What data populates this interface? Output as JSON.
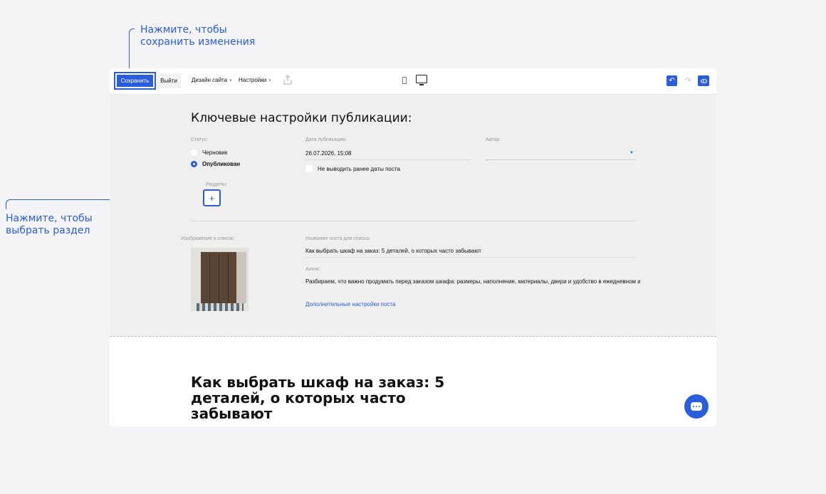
{
  "callouts": {
    "save_hint": "Нажмите, чтобы сохранить изменения",
    "section_hint": "Нажмите, чтобы выбрать раздел"
  },
  "toolbar": {
    "save_label": "Сохранить",
    "exit_label": "Выйти",
    "design_label": "Дизайн сайта",
    "settings_label": "Настройки",
    "caret": "▾",
    "share_icon": "upload-icon",
    "undo_glyph": "↶",
    "redo_glyph": "↷"
  },
  "panel": {
    "title": "Ключевые настройки публикации:",
    "status_label": "Статус:",
    "status_options": [
      "Черновик",
      "Опубликован"
    ],
    "status_selected": "Опубликован",
    "date_label": "Дата публикации:",
    "date_value": "26.07.2026, 15:08",
    "hide_date_label": "Не выводить ранее даты поста",
    "hide_date_checked": false,
    "author_label": "Автор:",
    "author_value": "",
    "sections_label": "Разделы:",
    "add_section_glyph": "+",
    "image_label": "Изображение в список:",
    "post_title_label": "Название поста для списка:",
    "post_title_value": "Как выбрать шкаф на заказ: 5 деталей, о которых часто забывают",
    "announce_label": "Анонс:",
    "announce_value": "Разбираем, что важно продумать перед заказом шкафа: размеры, наполнение, материалы, двери и удобство в ежедневном испо...",
    "more_settings_link": "Дополнительные настройки поста"
  },
  "post": {
    "heading": "Как выбрать шкаф на заказ: 5 деталей, о которых часто забывают"
  },
  "colors": {
    "accent": "#2a5cde",
    "panel_bg": "#efefef"
  }
}
